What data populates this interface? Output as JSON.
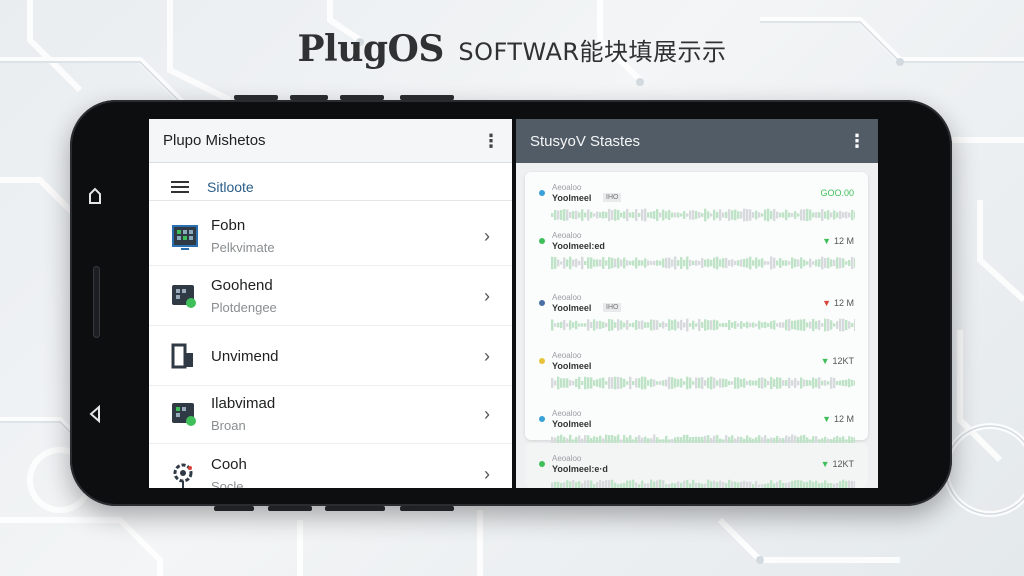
{
  "headline": {
    "brand": "PlugOS",
    "subtitle": "SOFTWAR能块填展示示"
  },
  "colors": {
    "accent_green": "#3fbf5a",
    "down_red": "#d9443b",
    "link_blue": "#2a5d8a",
    "header_gray": "#525c66"
  },
  "nav_buttons": [
    {
      "icon": "home-icon"
    },
    {
      "icon": "back-icon"
    }
  ],
  "left_panel": {
    "title": "Plupo Mishetos",
    "menu_icon": "kebab-menu-icon",
    "subheader": "Sitloote",
    "items": [
      {
        "icon": "monitor-icon",
        "title": "Fobn",
        "subtitle": "Pelkvimate"
      },
      {
        "icon": "app-grid-icon",
        "title": "Goohend",
        "subtitle": "Plotdengee"
      },
      {
        "icon": "phone-device-icon",
        "title": "Unvimend",
        "subtitle": ""
      },
      {
        "icon": "app-grid-icon",
        "title": "Ilabvimad",
        "subtitle": "Broan"
      },
      {
        "icon": "gear-pin-icon",
        "title": "Cooh",
        "subtitle": "Socle"
      }
    ]
  },
  "right_panel": {
    "title": "StusyoV Stastes",
    "menu_icon": "kebab-menu-icon",
    "rows": [
      {
        "name": "Aeoaloo",
        "label": "Yoolmeel",
        "tag": "IHO",
        "value": "GOO.00",
        "trend": "none",
        "dot": "#3aa0d8"
      },
      {
        "name": "Aeoaloo",
        "label": "Yoolmeel:ed",
        "tag": "",
        "value": "12 M",
        "trend": "up",
        "dot": "#3fbf5a"
      },
      {
        "name": "Aeoaloo",
        "label": "Yoolmeel",
        "tag": "IHO",
        "value": "12 M",
        "trend": "down",
        "dot": "#4a6fa5"
      },
      {
        "name": "Aeoaloo",
        "label": "Yoolmeel",
        "tag": "",
        "value": "12KT",
        "trend": "up",
        "dot": "#e8c33a"
      },
      {
        "name": "Aeoaloo",
        "label": "Yoolmeel",
        "tag": "",
        "value": "12 M",
        "trend": "up",
        "dot": "#3aa0d8"
      },
      {
        "name": "Aeoaloo",
        "label": "Yoolmeel:e·d",
        "tag": "",
        "value": "12KT",
        "trend": "up",
        "dot": "#3fbf5a"
      }
    ]
  }
}
